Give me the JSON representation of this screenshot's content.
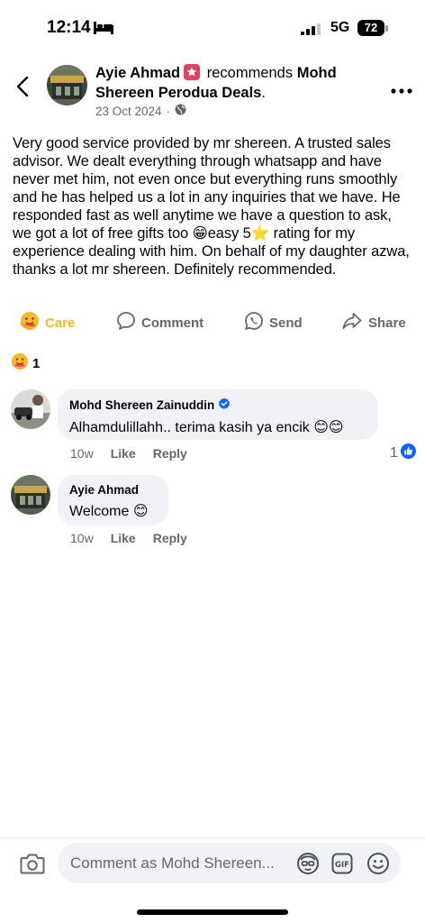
{
  "status_bar": {
    "time": "12:14",
    "network": "5G",
    "battery": "72"
  },
  "post": {
    "author": "Ayie Ahmad",
    "recommends_text": "recommends",
    "page_name": "Mohd Shereen Perodua Deals",
    "page_name_suffix": ".",
    "date": "23 Oct 2024",
    "dot": "·",
    "body": "Very good service provided by mr shereen. A trusted sales advisor. We dealt everything through whatsapp and have never met him, not even once but everything runs smoothly and he has helped us a lot in any inquiries that we have. He responded fast as well anytime we have a question to ask, we got a lot of free gifts too 😁easy 5⭐ rating for my experience dealing with him. On behalf of my daughter azwa, thanks a lot mr shereen. Definitely recommended."
  },
  "actions": {
    "care": "Care",
    "comment": "Comment",
    "send": "Send",
    "share": "Share"
  },
  "reactions": {
    "count": "1"
  },
  "comments": [
    {
      "name": "Mohd Shereen Zainuddin",
      "text": "Alhamdulillahh.. terima kasih ya encik 😊😊",
      "time": "10w",
      "like": "Like",
      "reply": "Reply",
      "likes": "1"
    },
    {
      "name": "Ayie Ahmad",
      "text": "Welcome 😊",
      "time": "10w",
      "like": "Like",
      "reply": "Reply"
    }
  ],
  "composer": {
    "placeholder": "Comment as Mohd Shereen..."
  },
  "colors": {
    "care": "#f7b928",
    "recommend_badge": "#e4415e",
    "verified": "#0866ff",
    "secondary_text": "#65676b",
    "bubble": "#f0f2f5"
  }
}
